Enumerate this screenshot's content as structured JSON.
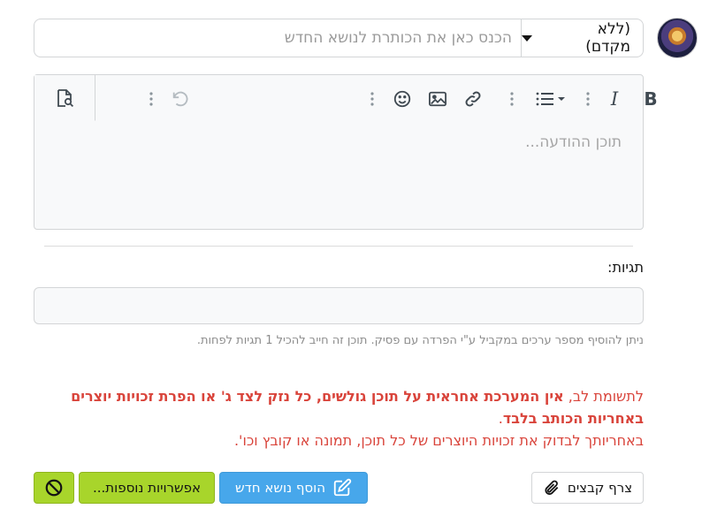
{
  "title_row": {
    "prefix_label": "(ללא מקדם)",
    "title_placeholder": "הכנס כאן את הכותרת לנושא החדש"
  },
  "editor": {
    "toolbar_icons": [
      "bold-icon",
      "italic-icon",
      "list-icon",
      "link-icon",
      "image-icon",
      "emoji-icon",
      "undo-icon",
      "preview-icon"
    ],
    "bold_label": "B",
    "italic_label": "I",
    "body_placeholder": "תוכן ההודעה..."
  },
  "tags": {
    "label": "תגיות:",
    "hint": "ניתן להוסיף מספר ערכים במקביל ע\"י הפרדה עם פסיק. תוכן זה חייב להכיל 1 תגיות לפחות."
  },
  "notice": {
    "lead": "לתשומת לב, ",
    "bold": "אין המערכת אחראית על תוכן גולשים, כל נזק לצד ג' או הפרת זכויות יוצרים באחריות הכותב בלבד",
    "bold_end": ".",
    "line2": "באחריותך לבדוק את זכויות היוצרים של כל תוכן, תמונה או קובץ וכו'."
  },
  "buttons": {
    "attach_label": "צרף קבצים",
    "submit_label": "הוסף נושא חדש",
    "more_label": "אפשרויות נוספות..."
  },
  "colors": {
    "accent_blue": "#47a7eb",
    "lime": "#a8d52b",
    "warning_red": "#d9443b"
  }
}
